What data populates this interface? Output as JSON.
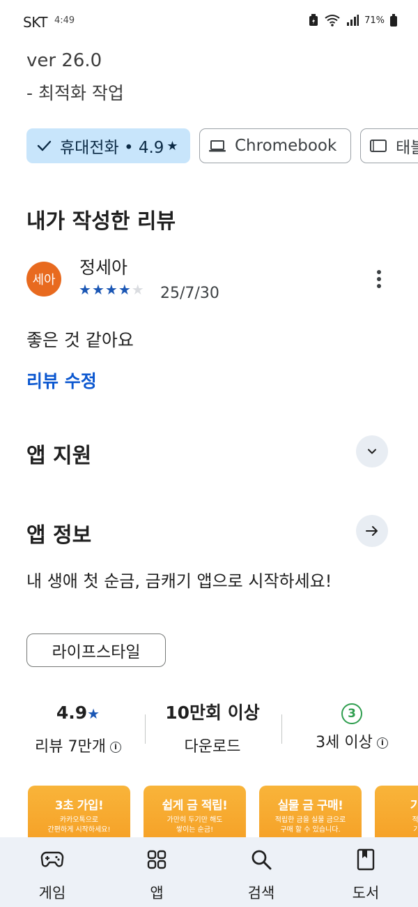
{
  "status_bar": {
    "carrier": "SKT",
    "time": "4:49",
    "battery": "71%"
  },
  "whats_new": {
    "version": "ver 26.0",
    "note": "- 최적화 작업"
  },
  "device_chips": [
    {
      "label": "휴대전화 • 4.9",
      "selected": true,
      "icon": "check-icon"
    },
    {
      "label": "Chromebook",
      "selected": false,
      "icon": "laptop-icon"
    },
    {
      "label": "태블릿",
      "selected": false,
      "icon": "tablet-icon"
    }
  ],
  "my_review": {
    "section_title": "내가 작성한 리뷰",
    "avatar_text": "세아",
    "avatar_color": "#e86a1f",
    "reviewer_name": "정세아",
    "rating": 4,
    "date": "25/7/30",
    "text": "좋은 것 같아요",
    "edit_label": "리뷰 수정"
  },
  "app_support": {
    "title": "앱 지원"
  },
  "app_info": {
    "title": "앱 정보",
    "description": "내 생애 첫 순금, 금캐기 앱으로 시작하세요!",
    "category": "라이프스타일"
  },
  "stats": {
    "rating_value": "4.9",
    "rating_label": "리뷰 7만개",
    "downloads_value": "10만회 이상",
    "downloads_label": "다운로드",
    "age_value": "3",
    "age_label": "3세 이상"
  },
  "screenshots": [
    {
      "title": "3초 가입!",
      "subtitle": "카카오톡으로\n간편하게 시작하세요!"
    },
    {
      "title": "쉽게 금 적립!",
      "subtitle": "가만히 두기만 해도\n쌓이는 순금!"
    },
    {
      "title": "실물 금 구매!",
      "subtitle": "적립한 금을 실물 금으로\n구매 할 수 있습니다."
    },
    {
      "title": "기프티",
      "subtitle": "적립한 금\n기프티콘"
    }
  ],
  "bottom_nav": [
    {
      "label": "게임",
      "icon": "gamepad-icon"
    },
    {
      "label": "앱",
      "icon": "apps-grid-icon"
    },
    {
      "label": "검색",
      "icon": "search-icon"
    },
    {
      "label": "도서",
      "icon": "book-icon"
    }
  ],
  "colors": {
    "accent_blue": "#0b57d0",
    "chip_selected_bg": "#c8e5fb",
    "star_blue": "#1a56b4",
    "age_green": "#2f9e4f",
    "nav_bg": "#edf1f7"
  }
}
